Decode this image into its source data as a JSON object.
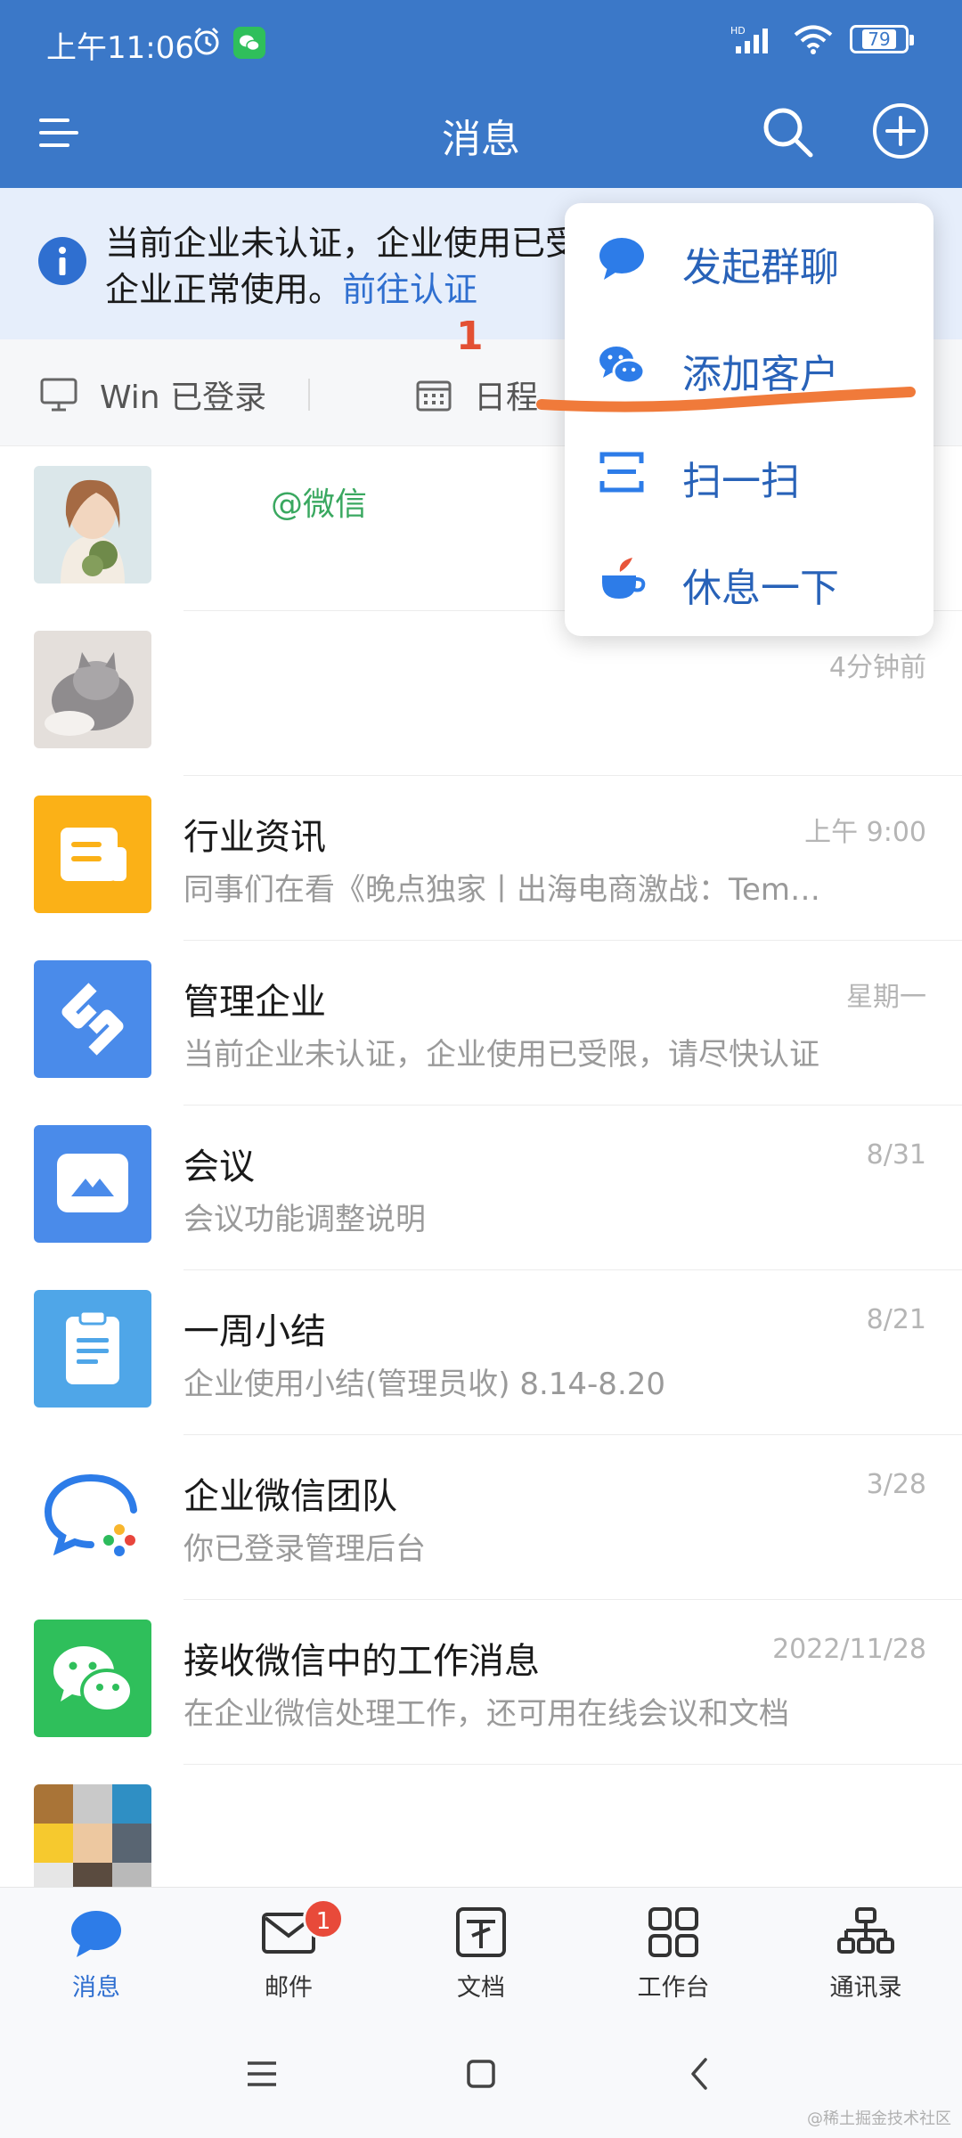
{
  "status_bar": {
    "time": "上午11:06",
    "battery": "79",
    "network": "HD"
  },
  "nav": {
    "title": "消息",
    "menu_icon": "menu-icon",
    "search_icon": "search-icon",
    "add_icon": "plus-circle-icon"
  },
  "notice": {
    "text_line1": "当前企业未认证，企业使用已受",
    "text_line2": "企业正常使用。",
    "link": "前往认证"
  },
  "quick_row": {
    "win_label": "Win 已登录",
    "schedule_label": "日程"
  },
  "annotation": {
    "step_number": "1",
    "highlight_color": "#f07a3a"
  },
  "dropdown": {
    "items": [
      {
        "label": "发起群聊",
        "icon": "chat-bubble-icon"
      },
      {
        "label": "添加客户",
        "icon": "wechat-icon"
      },
      {
        "label": "扫一扫",
        "icon": "scan-icon"
      },
      {
        "label": "休息一下",
        "icon": "tea-cup-icon"
      }
    ]
  },
  "messages": [
    {
      "title": "",
      "tag": "@微信",
      "preview": "",
      "time": "",
      "avatar": "girl-with-plant-avatar"
    },
    {
      "title": "",
      "tag": "",
      "preview": "",
      "time": "4分钟前",
      "avatar": "cat-avatar"
    },
    {
      "title": "行业资讯",
      "tag": "",
      "preview": "同事们在看《晚点独家丨出海电商激战：Tem…",
      "time": "上午 9:00",
      "avatar": "news-icon",
      "color": "#fbb117"
    },
    {
      "title": "管理企业",
      "tag": "",
      "preview": "当前企业未认证，企业使用已受限，请尽快认证",
      "time": "星期一",
      "avatar": "manage-icon",
      "color": "#4a8bea"
    },
    {
      "title": "会议",
      "tag": "",
      "preview": "会议功能调整说明",
      "time": "8/31",
      "avatar": "meeting-icon",
      "color": "#4a8bea"
    },
    {
      "title": "一周小结",
      "tag": "",
      "preview": "企业使用小结(管理员收) 8.14-8.20",
      "time": "8/21",
      "avatar": "clipboard-icon",
      "color": "#4fa6e8"
    },
    {
      "title": "企业微信团队",
      "tag": "",
      "preview": "你已登录管理后台",
      "time": "3/28",
      "avatar": "wecom-logo-icon"
    },
    {
      "title": "接收微信中的工作消息",
      "tag": "",
      "preview": "在企业微信处理工作，还可用在线会议和文档",
      "time": "2022/11/28",
      "avatar": "wechat-icon",
      "color": "#2fbf5b"
    },
    {
      "title": "",
      "tag": "",
      "preview": "",
      "time": "",
      "avatar": "mosaic-avatar"
    }
  ],
  "tabbar": {
    "tabs": [
      {
        "label": "消息",
        "icon": "message-icon",
        "active": true
      },
      {
        "label": "邮件",
        "icon": "mail-icon",
        "badge": "1"
      },
      {
        "label": "文档",
        "icon": "document-icon"
      },
      {
        "label": "工作台",
        "icon": "workbench-icon"
      },
      {
        "label": "通讯录",
        "icon": "contacts-icon"
      }
    ]
  },
  "watermark": "@稀土掘金技术社区",
  "colors": {
    "header": "#3b78c8",
    "accent": "#2f6fd0",
    "notice_bg": "#e6eefb"
  }
}
